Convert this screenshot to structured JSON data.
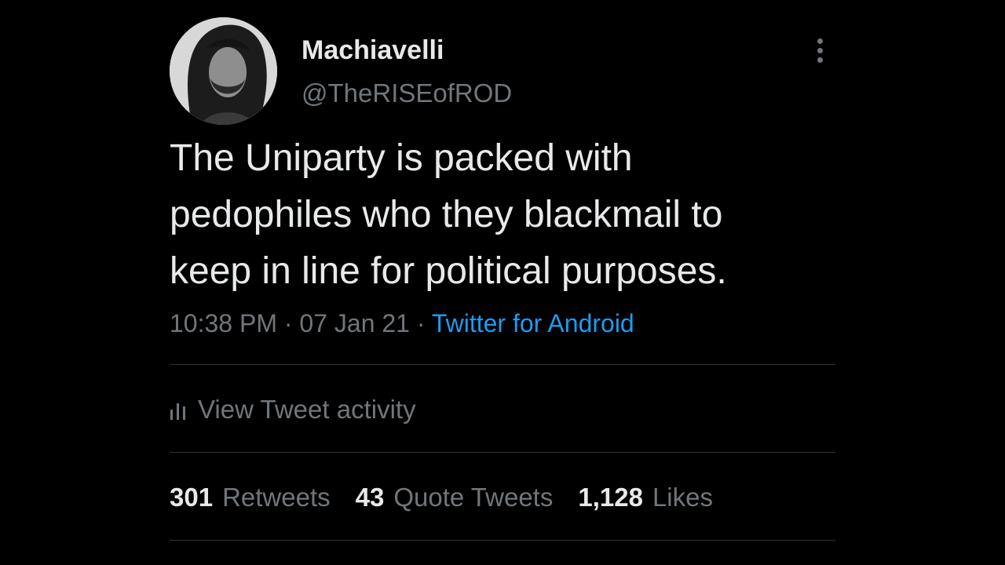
{
  "colors": {
    "background": "#000000",
    "primary_text": "#e7e9ea",
    "secondary_text": "#71767b",
    "link": "#1d9bf0",
    "divider": "#2f3336"
  },
  "author": {
    "display_name": "Machiavelli",
    "handle": "@TheRISEofROD",
    "avatar_icon": "profile-photo"
  },
  "menu": {
    "icon": "more-vertical-icon"
  },
  "tweet": {
    "lines": [
      "The Uniparty is packed with",
      "pedophiles who they blackmail to",
      "keep in line for political purposes."
    ]
  },
  "meta": {
    "time": "10:38 PM",
    "separator": " · ",
    "date": "07 Jan 21",
    "source": "Twitter for Android"
  },
  "activity": {
    "icon": "bar-chart-icon",
    "label": "View Tweet activity"
  },
  "stats": [
    {
      "count": "301",
      "label": "Retweets"
    },
    {
      "count": "43",
      "label": "Quote Tweets"
    },
    {
      "count": "1,128",
      "label": "Likes"
    }
  ]
}
